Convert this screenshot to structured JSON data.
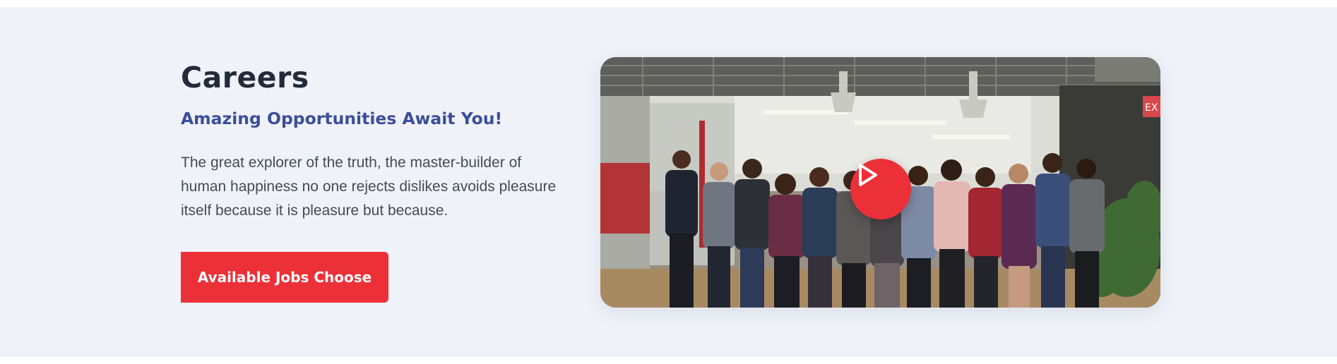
{
  "careers": {
    "title": "Careers",
    "subtitle": "Amazing Opportunities Await You!",
    "description": "The great explorer of the truth, the master-builder of human happiness no one rejects dislikes avoids pleasure itself because it is pleasure but because.",
    "button_label": "Available Jobs Choose"
  },
  "media": {
    "image": "team-photo",
    "play_icon": "play-icon",
    "exit_sign_text": "EX"
  },
  "colors": {
    "background": "#eff2f8",
    "title": "#232a3b",
    "subtitle": "#3b4e9a",
    "accent": "#ec3038",
    "body_text": "#454b56"
  }
}
